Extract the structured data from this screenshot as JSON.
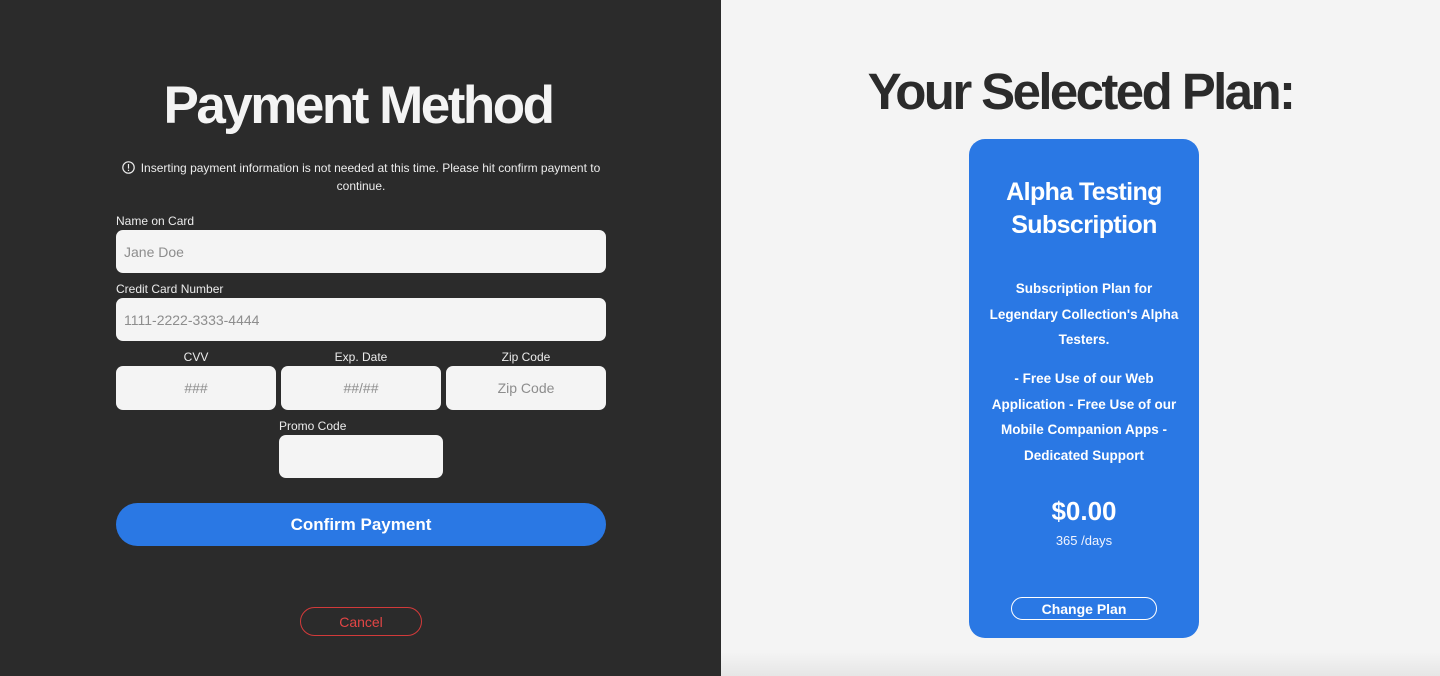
{
  "payment": {
    "title": "Payment Method",
    "notice_icon": "info-circle-icon",
    "notice": "Inserting payment information is not needed at this time. Please hit confirm payment to continue.",
    "name_label": "Name on Card",
    "name_placeholder": "Jane Doe",
    "card_label": "Credit Card Number",
    "card_placeholder": "1111-2222-3333-4444",
    "cvv_label": "CVV",
    "cvv_placeholder": "###",
    "exp_label": "Exp. Date",
    "exp_placeholder": "##/##",
    "zip_label": "Zip Code",
    "zip_placeholder": "Zip Code",
    "promo_label": "Promo Code",
    "promo_placeholder": "",
    "confirm_label": "Confirm Payment",
    "cancel_label": "Cancel"
  },
  "plan": {
    "heading": "Your Selected Plan:",
    "name": "Alpha Testing Subscription",
    "description": "Subscription Plan for Legendary Collection's Alpha Testers.",
    "features": "- Free Use of our Web Application - Free Use of our Mobile Companion Apps - Dedicated Support",
    "price": "$0.00",
    "period": "365 /days",
    "change_label": "Change Plan"
  },
  "colors": {
    "left_bg": "#2b2b2b",
    "right_bg": "#f4f4f4",
    "accent": "#2a78e4",
    "cancel": "#e24545"
  }
}
